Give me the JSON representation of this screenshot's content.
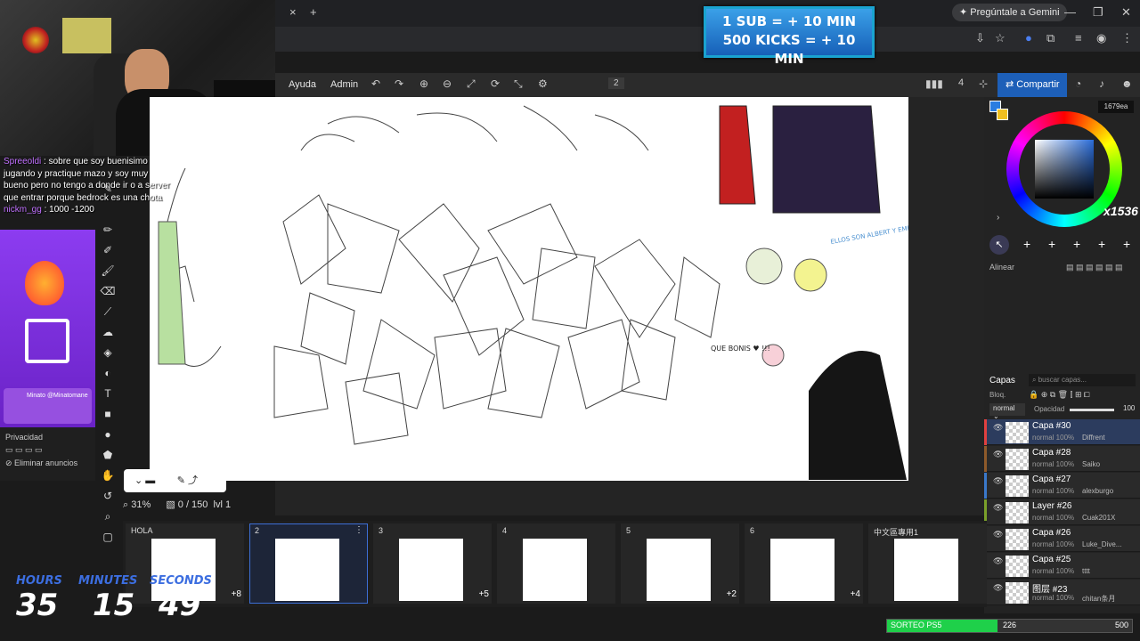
{
  "browser": {
    "gemini_label": "Pregúntale a Gemini",
    "tab_close": "×",
    "tab_new": "+"
  },
  "overlay_goal": {
    "line1": "1 SUB = + 10 MIN",
    "line2": "500 KICKS = + 10 MIN"
  },
  "app": {
    "menu": [
      "Ayuda",
      "Admin"
    ],
    "page_indicator": "2",
    "users_count": "4",
    "share_label": "Compartir",
    "zoom": "31%",
    "stroke_status": "0 / 150",
    "level": "lvl 1"
  },
  "chat": {
    "user1": "Spreeoldi",
    "msg1": ": sobre que soy buenisimo jugando y practique mazo y soy muy bueno pero no tengo a donde ir o a server que entrar porque bedrock es una chota",
    "user2": "nickm_gg",
    "msg2": ": 1000 -1200"
  },
  "promo": {
    "minato": "Minato @Minatomane",
    "privacy": "Privacidad",
    "remove_ads": "Eliminar anuncios"
  },
  "timer": {
    "hours_label": "HOURS",
    "minutes_label": "MINUTES",
    "seconds_label": "SECONDS",
    "hours": "35",
    "minutes": "15",
    "seconds": "49"
  },
  "color_panel": {
    "canvas_size": "1679ea",
    "brush_size": "x1536",
    "align_label": "Alinear",
    "swatch_primary": "#2a7de1",
    "swatch_secondary": "#f0c020",
    "brush_slots": [
      "1",
      "2",
      "3",
      "4",
      "5",
      "6"
    ]
  },
  "layers_panel": {
    "title": "Capas",
    "search_placeholder": "buscar capas...",
    "lock_label": "Bloq.",
    "blend": "normal",
    "opacity_label": "Opacidad",
    "opacity_value": "100",
    "layers": [
      {
        "name": "Capa #30",
        "meta": "normal 100%",
        "user": "Diffrent",
        "selected": true,
        "color": "#e04040"
      },
      {
        "name": "Capa #28",
        "meta": "normal 100%",
        "user": "Saiko",
        "selected": false,
        "color": "#8f5a2a"
      },
      {
        "name": "Capa #27",
        "meta": "normal 100%",
        "user": "alexburgo",
        "selected": false,
        "color": "#3a78c9"
      },
      {
        "name": "Layer #26",
        "meta": "normal 100%",
        "user": "Cuak201X",
        "selected": false,
        "color": "#7aa02a"
      },
      {
        "name": "Capa #26",
        "meta": "normal 100%",
        "user": "Luke_Dive...",
        "selected": false,
        "color": "#7aa02a"
      },
      {
        "name": "Capa #25",
        "meta": "normal 100%",
        "user": "tttt",
        "selected": false,
        "color": "#8a6a30"
      },
      {
        "name": "图层 #23",
        "meta": "normal 100%",
        "user": "chitan条月",
        "selected": false,
        "color": "#7aa02a"
      }
    ]
  },
  "pages": [
    {
      "label": "HOLA",
      "more": "+8",
      "selected": false
    },
    {
      "label": "2",
      "more": "",
      "selected": true
    },
    {
      "label": "3",
      "more": "+5",
      "selected": false
    },
    {
      "label": "4",
      "more": "",
      "selected": false
    },
    {
      "label": "5",
      "more": "+2",
      "selected": false
    },
    {
      "label": "6",
      "more": "+4",
      "selected": false
    },
    {
      "label": "中文區專用1",
      "more": "",
      "selected": false
    }
  ],
  "canvas_text": {
    "que_bonis": "QUE BONIS ♥ !!!",
    "ellos": "ELLOS SON ALBERT Y EMERSON"
  },
  "sorteo": {
    "label": "SORTEO PS5",
    "current": "226",
    "goal": "500",
    "progress": 0.452
  }
}
